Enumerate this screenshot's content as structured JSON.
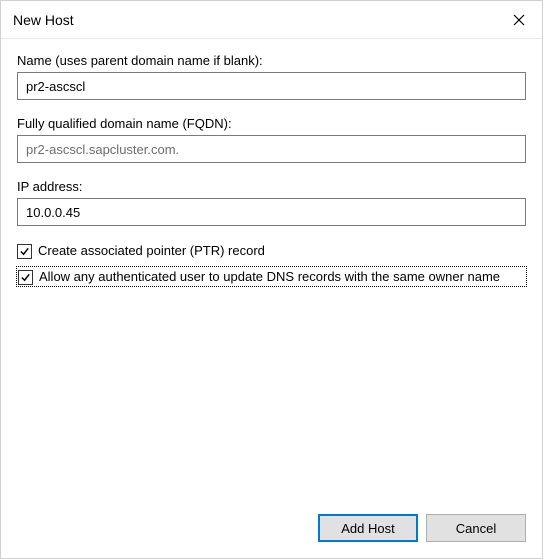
{
  "titlebar": {
    "title": "New Host"
  },
  "fields": {
    "name": {
      "label": "Name (uses parent domain name if blank):",
      "value": "pr2-ascscl"
    },
    "fqdn": {
      "label": "Fully qualified domain name (FQDN):",
      "value": "pr2-ascscl.sapcluster.com."
    },
    "ip": {
      "label": "IP address:",
      "value": "10.0.0.45"
    }
  },
  "checkboxes": {
    "ptr": {
      "label": "Create associated pointer (PTR) record",
      "checked": true
    },
    "allow_update": {
      "label": "Allow any authenticated user to update DNS records with the same owner name",
      "checked": true
    }
  },
  "buttons": {
    "add_host": "Add Host",
    "cancel": "Cancel"
  }
}
